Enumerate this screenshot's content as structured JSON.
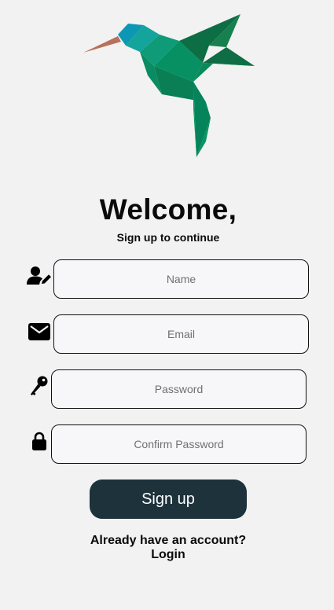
{
  "header": {
    "logo_icon": "hummingbird-logo",
    "title": "Welcome,",
    "subtitle": "Sign up to continue"
  },
  "form": {
    "fields": [
      {
        "name": "name",
        "icon": "user-edit-icon",
        "placeholder": "Name",
        "value": ""
      },
      {
        "name": "email",
        "icon": "envelope-icon",
        "placeholder": "Email",
        "value": ""
      },
      {
        "name": "password",
        "icon": "key-icon",
        "placeholder": "Password",
        "value": ""
      },
      {
        "name": "confirm_password",
        "icon": "lock-icon",
        "placeholder": "Confirm Password",
        "value": ""
      }
    ],
    "submit_label": "Sign up"
  },
  "footer": {
    "prompt": "Already have an account?",
    "login_label": "Login"
  },
  "colors": {
    "background": "#f1f2f1",
    "button": "#1d323b",
    "button_text": "#ffffff",
    "field_border": "#111111",
    "logo_green": "#0a8a5e",
    "logo_teal": "#0aa0b8",
    "logo_beak": "#b86a52"
  }
}
